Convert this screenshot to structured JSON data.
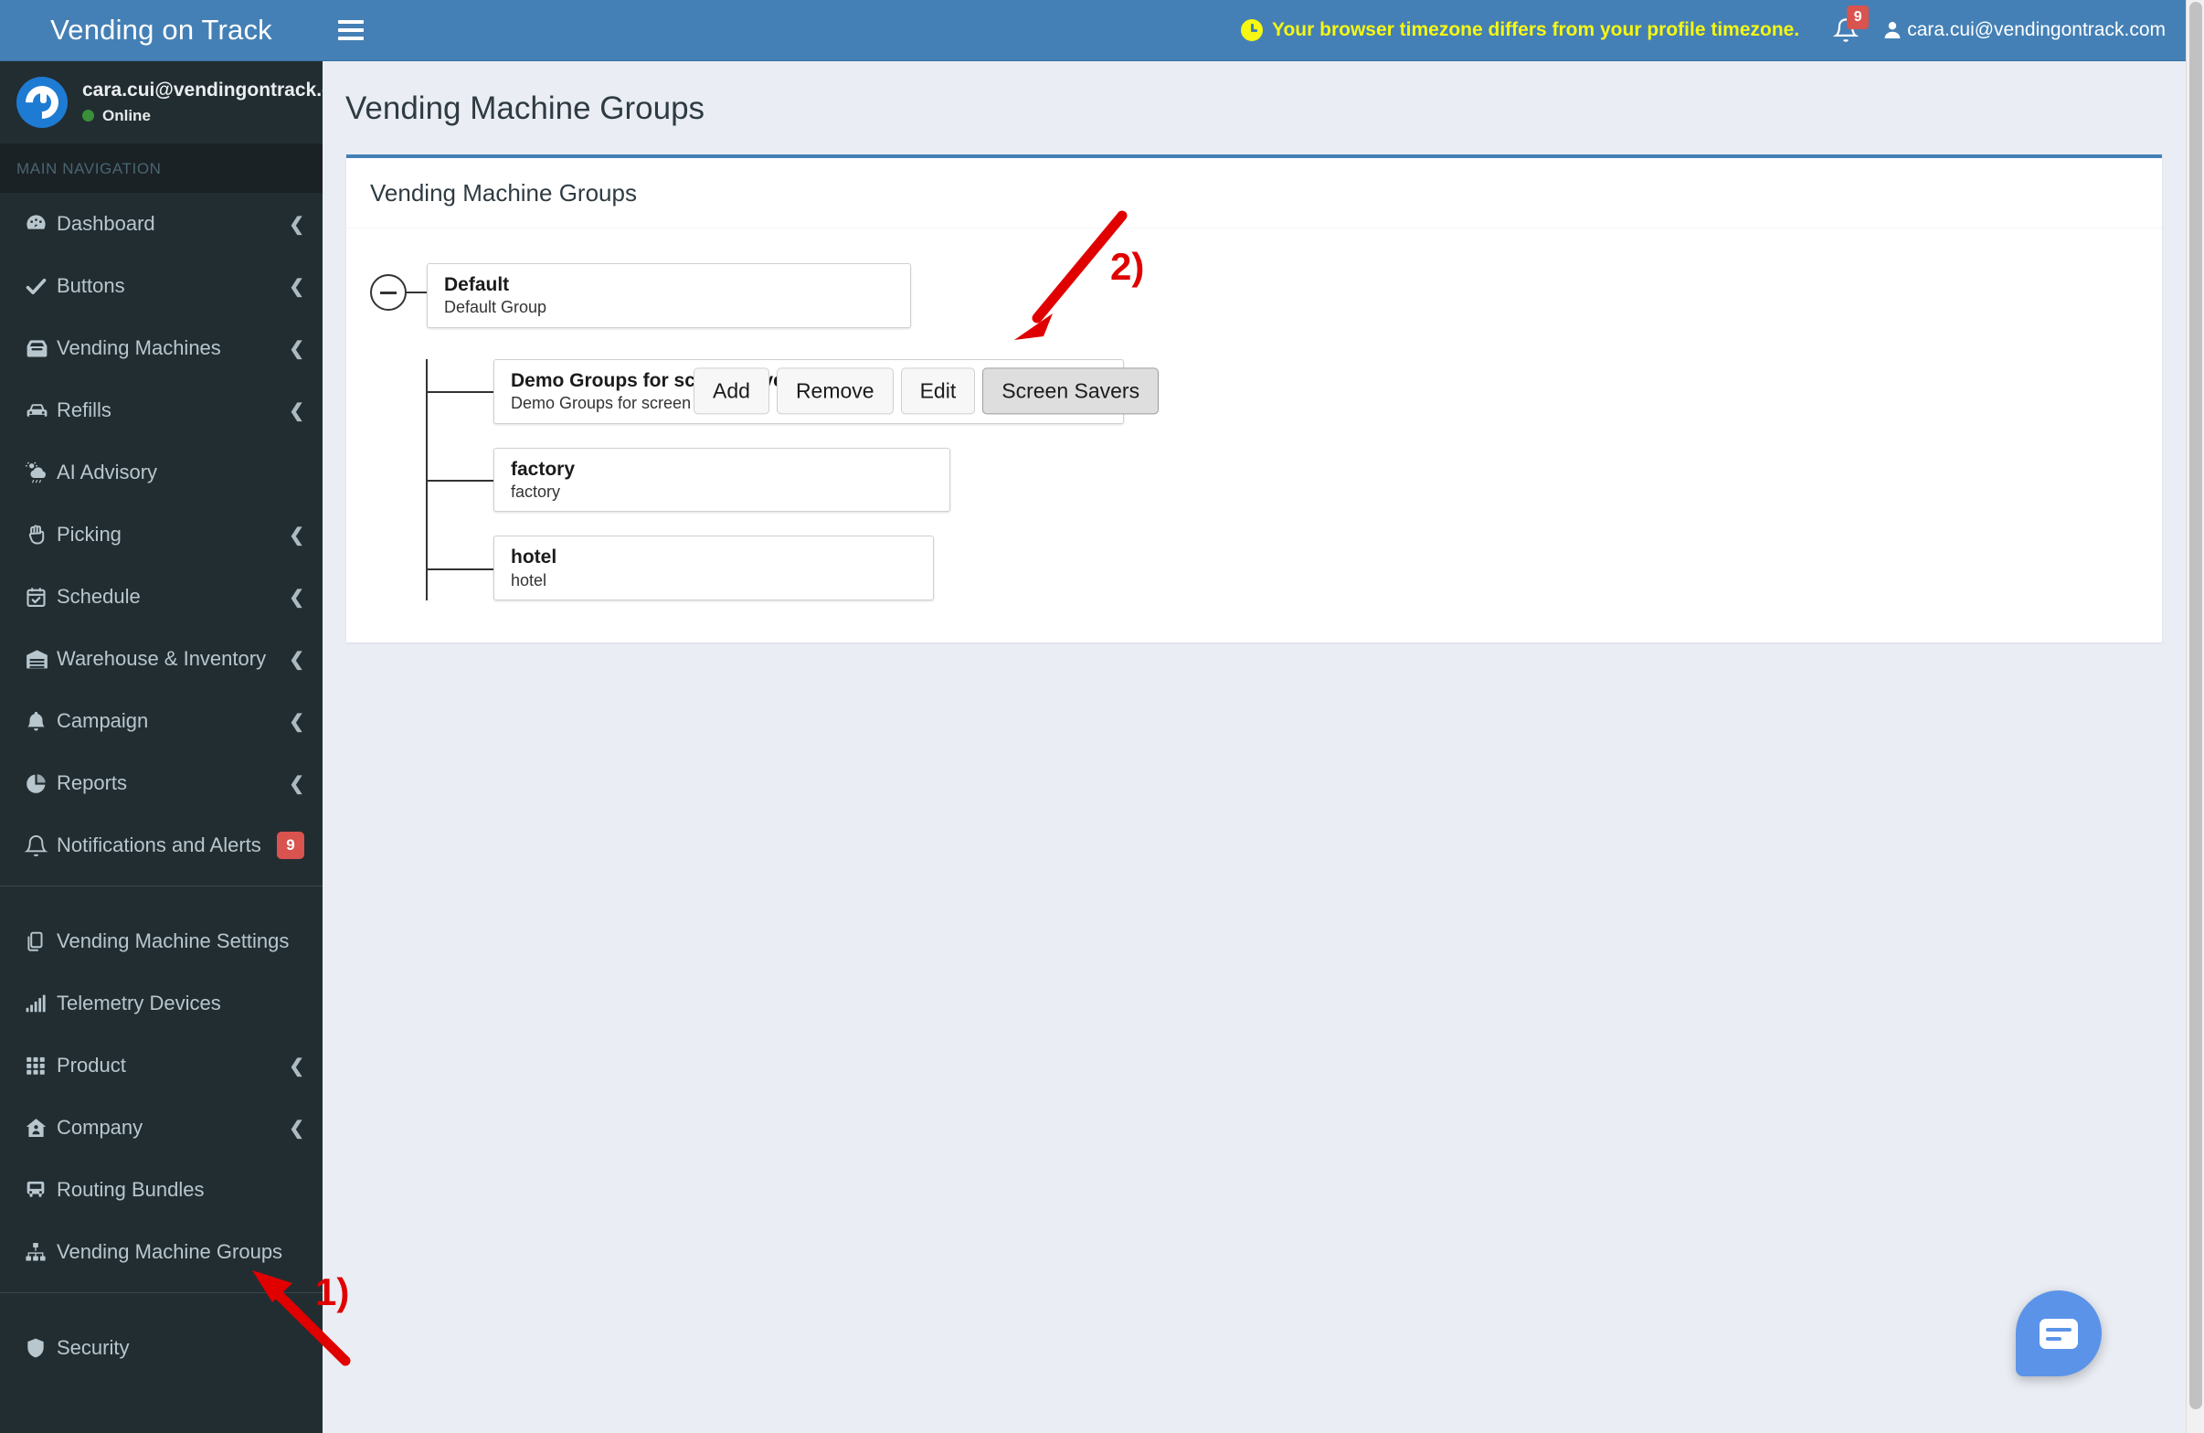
{
  "app": {
    "brand": "Vending on Track"
  },
  "topbar": {
    "menu_toggle_icon": "hamburger-icon",
    "timezone_warning": "Your browser timezone differs from your profile timezone.",
    "notifications_count": "9",
    "user_email": "cara.cui@vendingontrack.com"
  },
  "sidebar": {
    "user_email": "cara.cui@vendingontrack.c",
    "status": "Online",
    "nav_header": "MAIN NAVIGATION",
    "items": [
      {
        "label": "Dashboard",
        "icon": "dashboard-icon",
        "chevron": true
      },
      {
        "label": "Buttons",
        "icon": "check-icon",
        "chevron": true
      },
      {
        "label": "Vending Machines",
        "icon": "vending-machine-icon",
        "chevron": true
      },
      {
        "label": "Refills",
        "icon": "car-icon",
        "chevron": true
      },
      {
        "label": "AI Advisory",
        "icon": "cloud-sun-icon",
        "chevron": false
      },
      {
        "label": "Picking",
        "icon": "hand-icon",
        "chevron": true
      },
      {
        "label": "Schedule",
        "icon": "calendar-check-icon",
        "chevron": true
      },
      {
        "label": "Warehouse & Inventory",
        "icon": "warehouse-icon",
        "chevron": true
      },
      {
        "label": "Campaign",
        "icon": "bell-filled-icon",
        "chevron": true
      },
      {
        "label": "Reports",
        "icon": "pie-chart-icon",
        "chevron": true
      },
      {
        "label": "Notifications and Alerts",
        "icon": "bell-outline-icon",
        "chevron": false,
        "badge": "9"
      }
    ],
    "items2": [
      {
        "label": "Vending Machine Settings",
        "icon": "copy-icon",
        "chevron": false
      },
      {
        "label": "Telemetry Devices",
        "icon": "signal-bars-icon",
        "chevron": false
      },
      {
        "label": "Product",
        "icon": "grid-icon",
        "chevron": true
      },
      {
        "label": "Company",
        "icon": "home-user-icon",
        "chevron": true
      },
      {
        "label": "Routing Bundles",
        "icon": "bus-icon",
        "chevron": false
      },
      {
        "label": "Vending Machine Groups",
        "icon": "sitemap-icon",
        "chevron": false
      }
    ],
    "items3": [
      {
        "label": "Security",
        "icon": "shield-icon",
        "chevron": false
      }
    ]
  },
  "main": {
    "page_title": "Vending Machine Groups",
    "panel_title": "Vending Machine Groups",
    "tree": {
      "root": {
        "title": "Default",
        "subtitle": "Default Group",
        "toggle": "collapse-icon"
      },
      "children": [
        {
          "title": "Demo Groups for screen savers",
          "subtitle": "Demo Groups for screen savers",
          "buttons": [
            {
              "label": "Add",
              "active": false
            },
            {
              "label": "Remove",
              "active": false
            },
            {
              "label": "Edit",
              "active": false
            },
            {
              "label": "Screen Savers",
              "active": true
            }
          ]
        },
        {
          "title": "factory",
          "subtitle": "factory",
          "buttons": []
        },
        {
          "title": "hotel",
          "subtitle": "hotel",
          "buttons": []
        }
      ]
    }
  },
  "annotations": [
    {
      "id": "1",
      "label": "1)"
    },
    {
      "id": "2",
      "label": "2)"
    }
  ],
  "chat": {
    "icon": "chat-bubble-icon"
  },
  "colors": {
    "topbar": "#4480b5",
    "sidebar": "#222d32",
    "content_bg": "#eaedf4",
    "accent": "#4480b5",
    "warning_text": "#f6f712",
    "badge": "#d9534f",
    "annotation": "#e00000",
    "chat_fab": "#5b93e8",
    "online": "#3a8f3a"
  }
}
